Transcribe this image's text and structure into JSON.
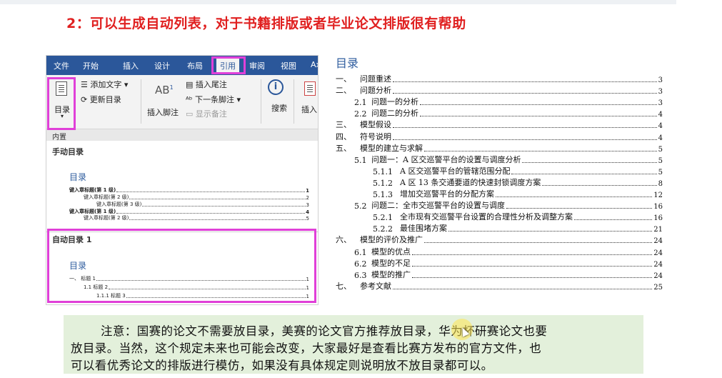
{
  "heading": "2：可以生成自动列表，对于书籍排版或者毕业论文排版很有帮助",
  "ribbon": {
    "tabs": [
      "文件",
      "开始",
      "插入",
      "设计",
      "布局",
      "引用",
      "审阅",
      "视图",
      "Ax"
    ],
    "active_tab": "引用",
    "toc_button": "目录",
    "add_text": "添加文字",
    "update_toc": "更新目录",
    "ab_label": "AB",
    "ab_sup": "1",
    "insert_footnote": "插入脚注",
    "insert_endnote": "插入尾注",
    "next_footnote": "下一条脚注",
    "show_notes": "显示备注",
    "search": "搜索",
    "search2": "索",
    "insert_cite": "插入"
  },
  "dropdown": {
    "builtin": "内置",
    "manual_title": "手动目录",
    "manual_toc_head": "目录",
    "manual_lines": [
      {
        "text": "键入章标题(第 1 级)",
        "page": "1"
      },
      {
        "text": "键入章标题(第 2 级)",
        "page": "2"
      },
      {
        "text": "键入章标题(第 3 级)",
        "page": "3"
      },
      {
        "text": "键入章标题(第 1 级)",
        "page": "4"
      },
      {
        "text": "键入章标题(第 2 级)",
        "page": "5"
      }
    ],
    "auto_title": "自动目录 1",
    "auto_toc_head": "目录",
    "auto_lines": [
      {
        "text": "一、 标题 1",
        "page": "1"
      },
      {
        "text": "1.1 标题 2",
        "page": "1"
      },
      {
        "text": "1.1.1 标题 3",
        "page": "1"
      }
    ]
  },
  "toc": {
    "title": "目录",
    "rows": [
      {
        "num": "一、",
        "text": "问题重述",
        "page": "3"
      },
      {
        "num": "二、",
        "text": "问题分析",
        "page": "3"
      },
      {
        "num": "2.1",
        "text": "问题一的分析",
        "page": "3"
      },
      {
        "num": "2.2",
        "text": "问题二的分析",
        "page": "4"
      },
      {
        "num": "三、",
        "text": "模型假设",
        "page": "4"
      },
      {
        "num": "四、",
        "text": "符号说明",
        "page": "4"
      },
      {
        "num": "五、",
        "text": "模型的建立与求解",
        "page": "5"
      },
      {
        "num": "5.1",
        "text": "问题一：A 区交巡警平台的设置与调度分析",
        "page": "5"
      },
      {
        "num": "5.1.1",
        "text": "A 区交巡警平台的管辖范围分配",
        "page": "5"
      },
      {
        "num": "5.1.2",
        "text": "A 区 13 条交通要道的快速封锁调度方案",
        "page": "8"
      },
      {
        "num": "5.1.3",
        "text": "增加交巡警平台的分配方案",
        "page": "12"
      },
      {
        "num": "5.2",
        "text": "问题二：全市交巡警平台的设置与调度",
        "page": "16"
      },
      {
        "num": "5.2.1",
        "text": "全市现有交巡警平台设置的合理性分析及调整方案",
        "page": "16"
      },
      {
        "num": "5.2.2",
        "text": "最佳围堵方案",
        "page": "21"
      },
      {
        "num": "六、",
        "text": "模型的评价及推广",
        "page": "24"
      },
      {
        "num": "6.1",
        "text": "模型的优点",
        "page": "24"
      },
      {
        "num": "6.2",
        "text": "模型的不足",
        "page": "24"
      },
      {
        "num": "6.3",
        "text": "模型的推广",
        "page": "24"
      },
      {
        "num": "七、",
        "text": "参考文献",
        "page": "25"
      }
    ]
  },
  "note": {
    "line1": "注意：国赛的论文不需要放目录，美赛的论文官方推荐放目录，华为杯研赛论文也要",
    "line2": "放目录。当然，这个规定未来也可能会改变，大家最好是查看比赛方发布的官方文件，也",
    "line3": "可以看优秀论文的排版进行模仿，如果没有具体规定则说明放不放目录都可以。"
  },
  "colors": {
    "heading": "#e02020",
    "ribbon_blue": "#2b579a",
    "highlight": "#e040d8",
    "toc_title": "#2e5c9e",
    "note_bg": "#e3f0db"
  }
}
